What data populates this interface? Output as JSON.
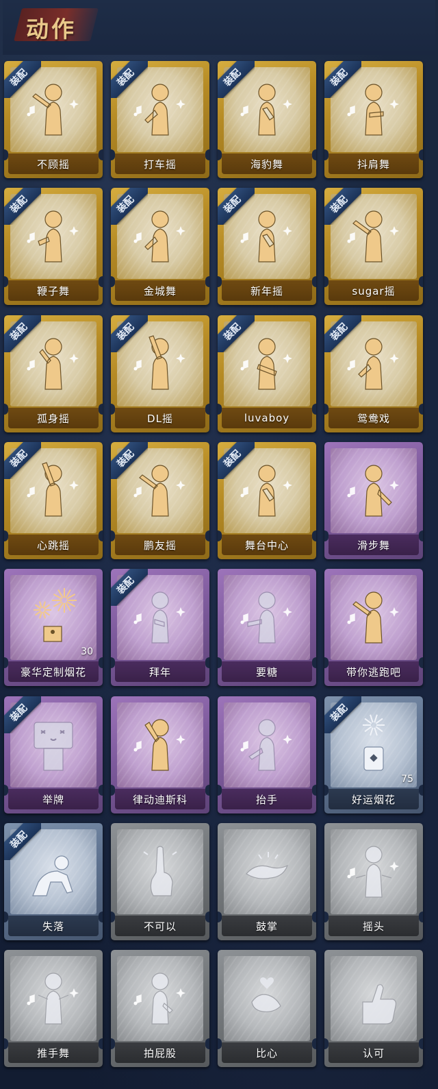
{
  "header": {
    "title": "动作"
  },
  "badge_text": "装配",
  "cards": [
    {
      "label": "不顾摇",
      "tier": "gold",
      "equipped": true,
      "icon": "dance-point-icon"
    },
    {
      "label": "打车摇",
      "tier": "gold",
      "equipped": true,
      "icon": "dance-sway-icon"
    },
    {
      "label": "海豹舞",
      "tier": "gold",
      "equipped": true,
      "icon": "dance-clap-icon"
    },
    {
      "label": "抖肩舞",
      "tier": "gold",
      "equipped": true,
      "icon": "dance-shoulder-icon"
    },
    {
      "label": "鞭子舞",
      "tier": "gold",
      "equipped": true,
      "icon": "dance-whip-icon"
    },
    {
      "label": "金城舞",
      "tier": "gold",
      "equipped": true,
      "icon": "dance-sway-icon"
    },
    {
      "label": "新年摇",
      "tier": "gold",
      "equipped": true,
      "icon": "dance-clap-icon"
    },
    {
      "label": "sugar摇",
      "tier": "gold",
      "equipped": true,
      "icon": "dance-point-icon"
    },
    {
      "label": "孤身摇",
      "tier": "gold",
      "equipped": true,
      "icon": "dance-arms-up-icon"
    },
    {
      "label": "DL摇",
      "tier": "gold",
      "equipped": true,
      "icon": "dance-raise-icon"
    },
    {
      "label": "luvaboy",
      "tier": "gold",
      "equipped": true,
      "icon": "dance-cross-icon"
    },
    {
      "label": "鸳鸯戏",
      "tier": "gold",
      "equipped": true,
      "icon": "dance-sway-icon"
    },
    {
      "label": "心跳摇",
      "tier": "gold",
      "equipped": true,
      "icon": "dance-raise-icon"
    },
    {
      "label": "鹏友摇",
      "tier": "gold",
      "equipped": true,
      "icon": "dance-point-icon"
    },
    {
      "label": "舞台中心",
      "tier": "gold",
      "equipped": true,
      "icon": "dance-clap-icon"
    },
    {
      "label": "滑步舞",
      "tier": "purple",
      "equipped": false,
      "icon": "dance-slide-icon"
    },
    {
      "label": "豪华定制烟花",
      "tier": "purple",
      "equipped": false,
      "icon": "fireworks-icon",
      "count": "30"
    },
    {
      "label": "拜年",
      "tier": "purple",
      "equipped": true,
      "icon": "bow-greeting-icon",
      "ghost": true
    },
    {
      "label": "要糖",
      "tier": "purple",
      "equipped": false,
      "icon": "ask-candy-icon",
      "ghost": true
    },
    {
      "label": "带你逃跑吧",
      "tier": "purple",
      "equipped": false,
      "icon": "dance-point-icon"
    },
    {
      "label": "举牌",
      "tier": "purple",
      "equipped": true,
      "icon": "hold-sign-icon",
      "ghost": true
    },
    {
      "label": "律动迪斯科",
      "tier": "purple",
      "equipped": false,
      "icon": "disco-icon"
    },
    {
      "label": "抬手",
      "tier": "purple",
      "equipped": false,
      "icon": "raise-hand-icon",
      "ghost": true
    },
    {
      "label": "好运烟花",
      "tier": "blue",
      "equipped": true,
      "icon": "firecracker-icon",
      "count": "75"
    },
    {
      "label": "失落",
      "tier": "blue",
      "equipped": true,
      "icon": "crawl-icon"
    },
    {
      "label": "不可以",
      "tier": "gray",
      "equipped": false,
      "icon": "finger-wag-icon"
    },
    {
      "label": "鼓掌",
      "tier": "gray",
      "equipped": false,
      "icon": "clap-hands-icon"
    },
    {
      "label": "摇头",
      "tier": "gray",
      "equipped": false,
      "icon": "shake-head-icon"
    },
    {
      "label": "推手舞",
      "tier": "gray",
      "equipped": false,
      "icon": "push-hands-icon"
    },
    {
      "label": "拍屁股",
      "tier": "gray",
      "equipped": false,
      "icon": "pat-icon"
    },
    {
      "label": "比心",
      "tier": "gray",
      "equipped": false,
      "icon": "finger-heart-icon"
    },
    {
      "label": "认可",
      "tier": "gray",
      "equipped": false,
      "icon": "thumbs-up-icon"
    }
  ],
  "colors": {
    "gold": "#c9a032",
    "purple": "#8a65a8",
    "blue": "#6b7f9c",
    "gray": "#7e8285",
    "badge": "#23406a"
  }
}
